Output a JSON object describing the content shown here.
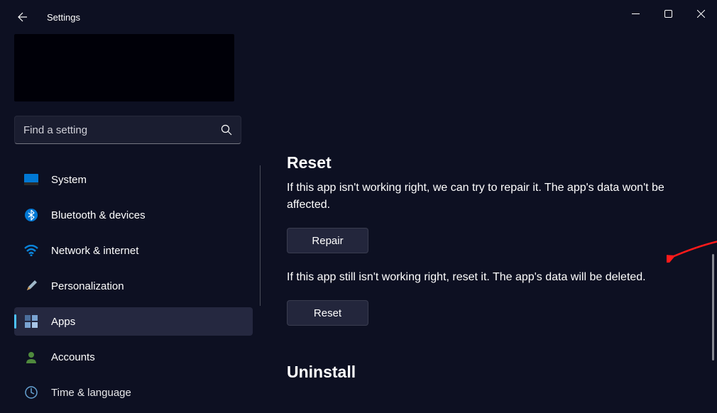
{
  "window": {
    "title": "Settings"
  },
  "search": {
    "placeholder": "Find a setting"
  },
  "nav": {
    "items": [
      {
        "label": "System"
      },
      {
        "label": "Bluetooth & devices"
      },
      {
        "label": "Network & internet"
      },
      {
        "label": "Personalization"
      },
      {
        "label": "Apps"
      },
      {
        "label": "Accounts"
      },
      {
        "label": "Time & language"
      }
    ]
  },
  "main": {
    "reset_heading": "Reset",
    "repair_desc": "If this app isn't working right, we can try to repair it. The app's data won't be affected.",
    "repair_btn": "Repair",
    "reset_desc": "If this app still isn't working right, reset it. The app's data will be deleted.",
    "reset_btn": "Reset",
    "uninstall_heading": "Uninstall"
  }
}
